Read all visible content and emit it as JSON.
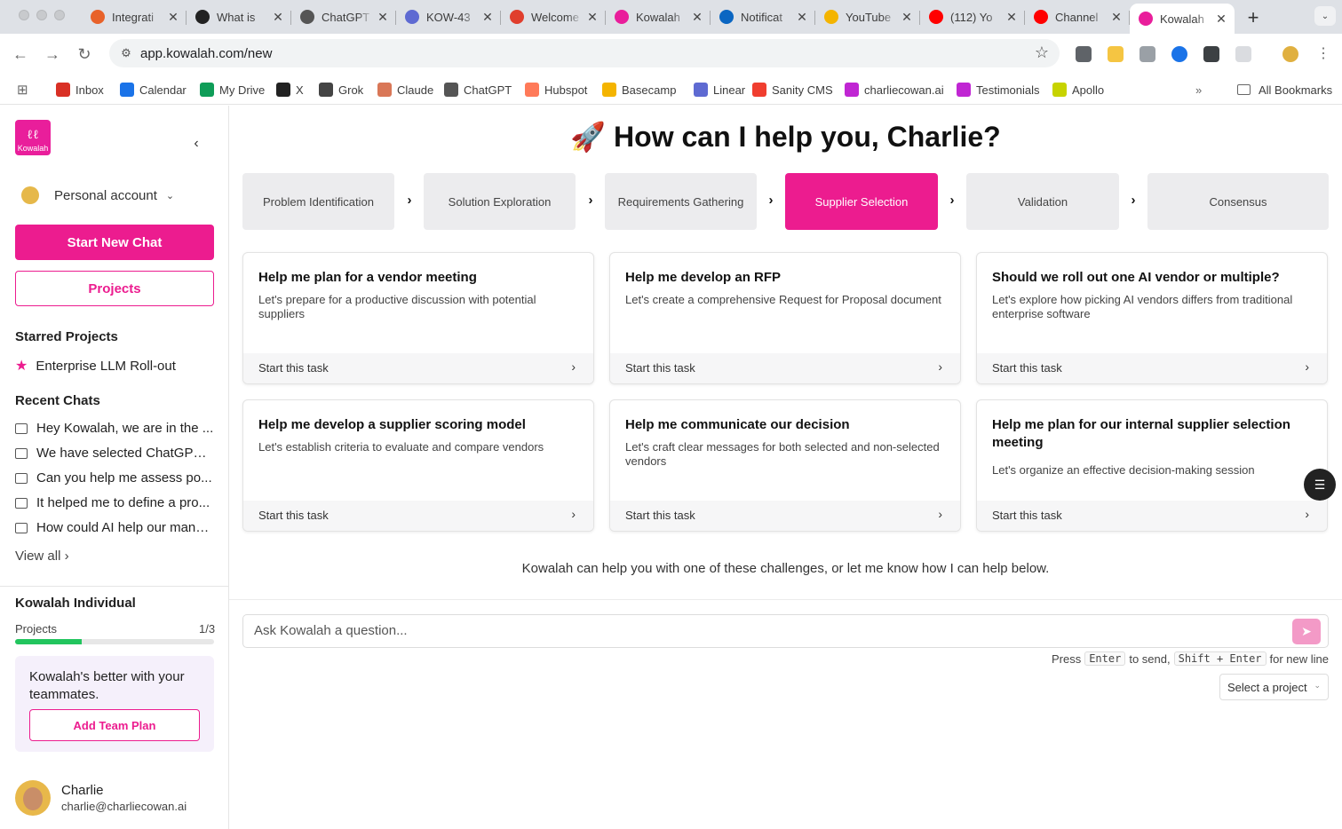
{
  "browser": {
    "tabs": [
      {
        "label": "Integrati",
        "color": "#e8622a"
      },
      {
        "label": "What is",
        "color": "#222222"
      },
      {
        "label": "ChatGPT",
        "color": "#555555"
      },
      {
        "label": "KOW-43",
        "color": "#5e6ad2"
      },
      {
        "label": "Welcome",
        "color": "#e03e2d"
      },
      {
        "label": "Kowalah",
        "color": "#e91e9b"
      },
      {
        "label": "Notificat",
        "color": "#0a66c2"
      },
      {
        "label": "YouTube",
        "color": "#f4b400"
      },
      {
        "label": "(112) Yo",
        "color": "#ff0000"
      },
      {
        "label": "Channel",
        "color": "#ff0000"
      },
      {
        "label": "Kowalah",
        "color": "#e91e9b",
        "active": true
      }
    ],
    "url": "app.kowalah.com/new",
    "bookmarks": [
      {
        "label": "Inbox",
        "color": "#d93025"
      },
      {
        "label": "Calendar",
        "color": "#1a73e8"
      },
      {
        "label": "My Drive",
        "color": "#0f9d58"
      },
      {
        "label": "X",
        "color": "#222222"
      },
      {
        "label": "Grok",
        "color": "#444444"
      },
      {
        "label": "Claude",
        "color": "#d97757"
      },
      {
        "label": "ChatGPT",
        "color": "#555555"
      },
      {
        "label": "Hubspot",
        "color": "#ff7a59"
      },
      {
        "label": "Basecamp",
        "color": "#f4b400"
      },
      {
        "label": "Linear",
        "color": "#5e6ad2"
      },
      {
        "label": "Sanity CMS",
        "color": "#f03e2f"
      },
      {
        "label": "charliecowan.ai",
        "color": "#c026d3"
      },
      {
        "label": "Testimonials",
        "color": "#c026d3"
      },
      {
        "label": "Apollo",
        "color": "#c7d300"
      }
    ],
    "all_bookmarks": "All Bookmarks"
  },
  "sidebar": {
    "logo_text": "Kowalah",
    "account": "Personal account",
    "start_new_chat": "Start New Chat",
    "projects": "Projects",
    "starred_title": "Starred Projects",
    "starred": [
      "Enterprise LLM Roll-out"
    ],
    "recent_title": "Recent Chats",
    "recent": [
      "Hey Kowalah, we are in the ...",
      "We have selected ChatGPT ...",
      "Can you help me assess po...",
      "It helped me to define a pro...",
      "How could AI help our manu..."
    ],
    "view_all": "View all",
    "plan": {
      "title": "Kowalah Individual",
      "projects_label": "Projects",
      "projects_count": "1/3",
      "projects_fraction": 0.333
    },
    "team_box": {
      "text": "Kowalah's better with your teammates.",
      "button": "Add Team Plan"
    },
    "user": {
      "name": "Charlie",
      "email": "charlie@charliecowan.ai"
    }
  },
  "main": {
    "headline": "🚀 How can I help you, Charlie?",
    "steps": [
      {
        "label": "Problem Identification"
      },
      {
        "label": "Solution Exploration"
      },
      {
        "label": "Requirements Gathering"
      },
      {
        "label": "Supplier Selection",
        "active": true
      },
      {
        "label": "Validation"
      },
      {
        "label": "Consensus"
      }
    ],
    "cards": [
      {
        "title": "Help me plan for a vendor meeting",
        "desc": "Let's prepare for a productive discussion with potential suppliers",
        "cta": "Start this task"
      },
      {
        "title": "Help me develop an RFP",
        "desc": "Let's create a comprehensive Request for Proposal document",
        "cta": "Start this task"
      },
      {
        "title": "Should we roll out one AI vendor or multiple?",
        "desc": "Let's explore how picking AI vendors differs from traditional enterprise software",
        "cta": "Start this task"
      },
      {
        "title": "Help me develop a supplier scoring model",
        "desc": "Let's establish criteria to evaluate and compare vendors",
        "cta": "Start this task"
      },
      {
        "title": "Help me communicate our decision",
        "desc": "Let's craft clear messages for both selected and non-selected vendors",
        "cta": "Start this task"
      },
      {
        "title": "Help me plan for our internal supplier selection meeting",
        "desc": "Let's organize an effective decision-making session",
        "cta": "Start this task"
      }
    ],
    "helper_text": "Kowalah can help you with one of these challenges, or let me know how I can help below.",
    "input_placeholder": "Ask Kowalah a question...",
    "hint": {
      "press": "Press",
      "enter": "Enter",
      "to_send": "to send,",
      "shift_enter": "Shift + Enter",
      "new_line": "for new line"
    },
    "select_project": "Select a project"
  },
  "colors": {
    "accent": "#ec1c8f",
    "progress": "#22c55e"
  }
}
